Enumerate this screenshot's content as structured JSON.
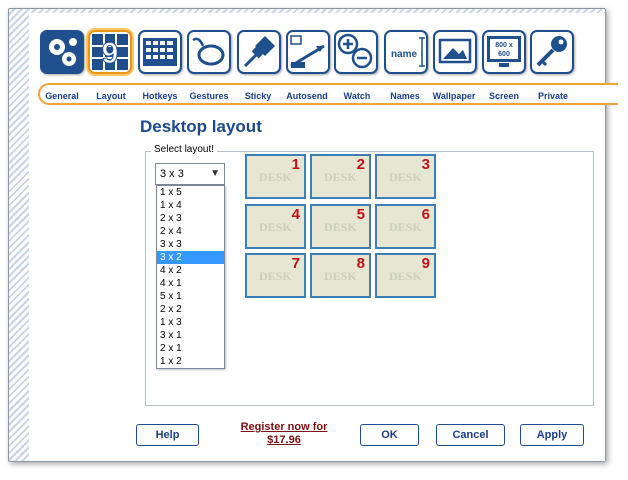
{
  "toolbar": [
    {
      "icon": "gears-icon",
      "label": "General"
    },
    {
      "icon": "grid-9-icon",
      "label": "Layout",
      "selected": true
    },
    {
      "icon": "keyboard-icon",
      "label": "Hotkeys"
    },
    {
      "icon": "mouse-icon",
      "label": "Gestures"
    },
    {
      "icon": "pushpin-icon",
      "label": "Sticky"
    },
    {
      "icon": "autosend-icon",
      "label": "Autosend"
    },
    {
      "icon": "zoom-in-out-icon",
      "label": "Watch"
    },
    {
      "icon": "name-icon",
      "label": "Names",
      "icon_text": "name"
    },
    {
      "icon": "wallpaper-icon",
      "label": "Wallpaper"
    },
    {
      "icon": "screen-monitor-icon",
      "label": "Screen",
      "icon_text_1": "800 x",
      "icon_text_2": "600"
    },
    {
      "icon": "key-icon",
      "label": "Private"
    }
  ],
  "page": {
    "title": "Desktop layout",
    "group_label": "Select layout!"
  },
  "select": {
    "value": "3 x 3",
    "options": [
      "1 x 5",
      "1 x 4",
      "2 x 3",
      "2 x 4",
      "3 x 3",
      "3 x 2",
      "4 x 2",
      "4 x 1",
      "5 x 1",
      "2 x 2",
      "1 x 3",
      "3 x 1",
      "2 x 1",
      "1 x 2"
    ],
    "highlighted": "3 x 2"
  },
  "grid": {
    "cells": [
      {
        "label": "DESK",
        "num": "1"
      },
      {
        "label": "DESK",
        "num": "2"
      },
      {
        "label": "DESK",
        "num": "3"
      },
      {
        "label": "DESK",
        "num": "4"
      },
      {
        "label": "DESK",
        "num": "5"
      },
      {
        "label": "DESK",
        "num": "6"
      },
      {
        "label": "DESK",
        "num": "7"
      },
      {
        "label": "DESK",
        "num": "8"
      },
      {
        "label": "DESK",
        "num": "9"
      }
    ]
  },
  "buttons": {
    "help": "Help",
    "ok": "OK",
    "cancel": "Cancel",
    "apply": "Apply"
  },
  "register": {
    "line1": "Register now for",
    "line2": "$17.96"
  },
  "colors": {
    "accent_orange": "#f0a53a",
    "navy": "#1b3f8a",
    "cell_bg": "#e6e6d3",
    "cell_border": "#3a7fb6",
    "number_red": "#c0101a",
    "highlight": "#3399ff"
  }
}
